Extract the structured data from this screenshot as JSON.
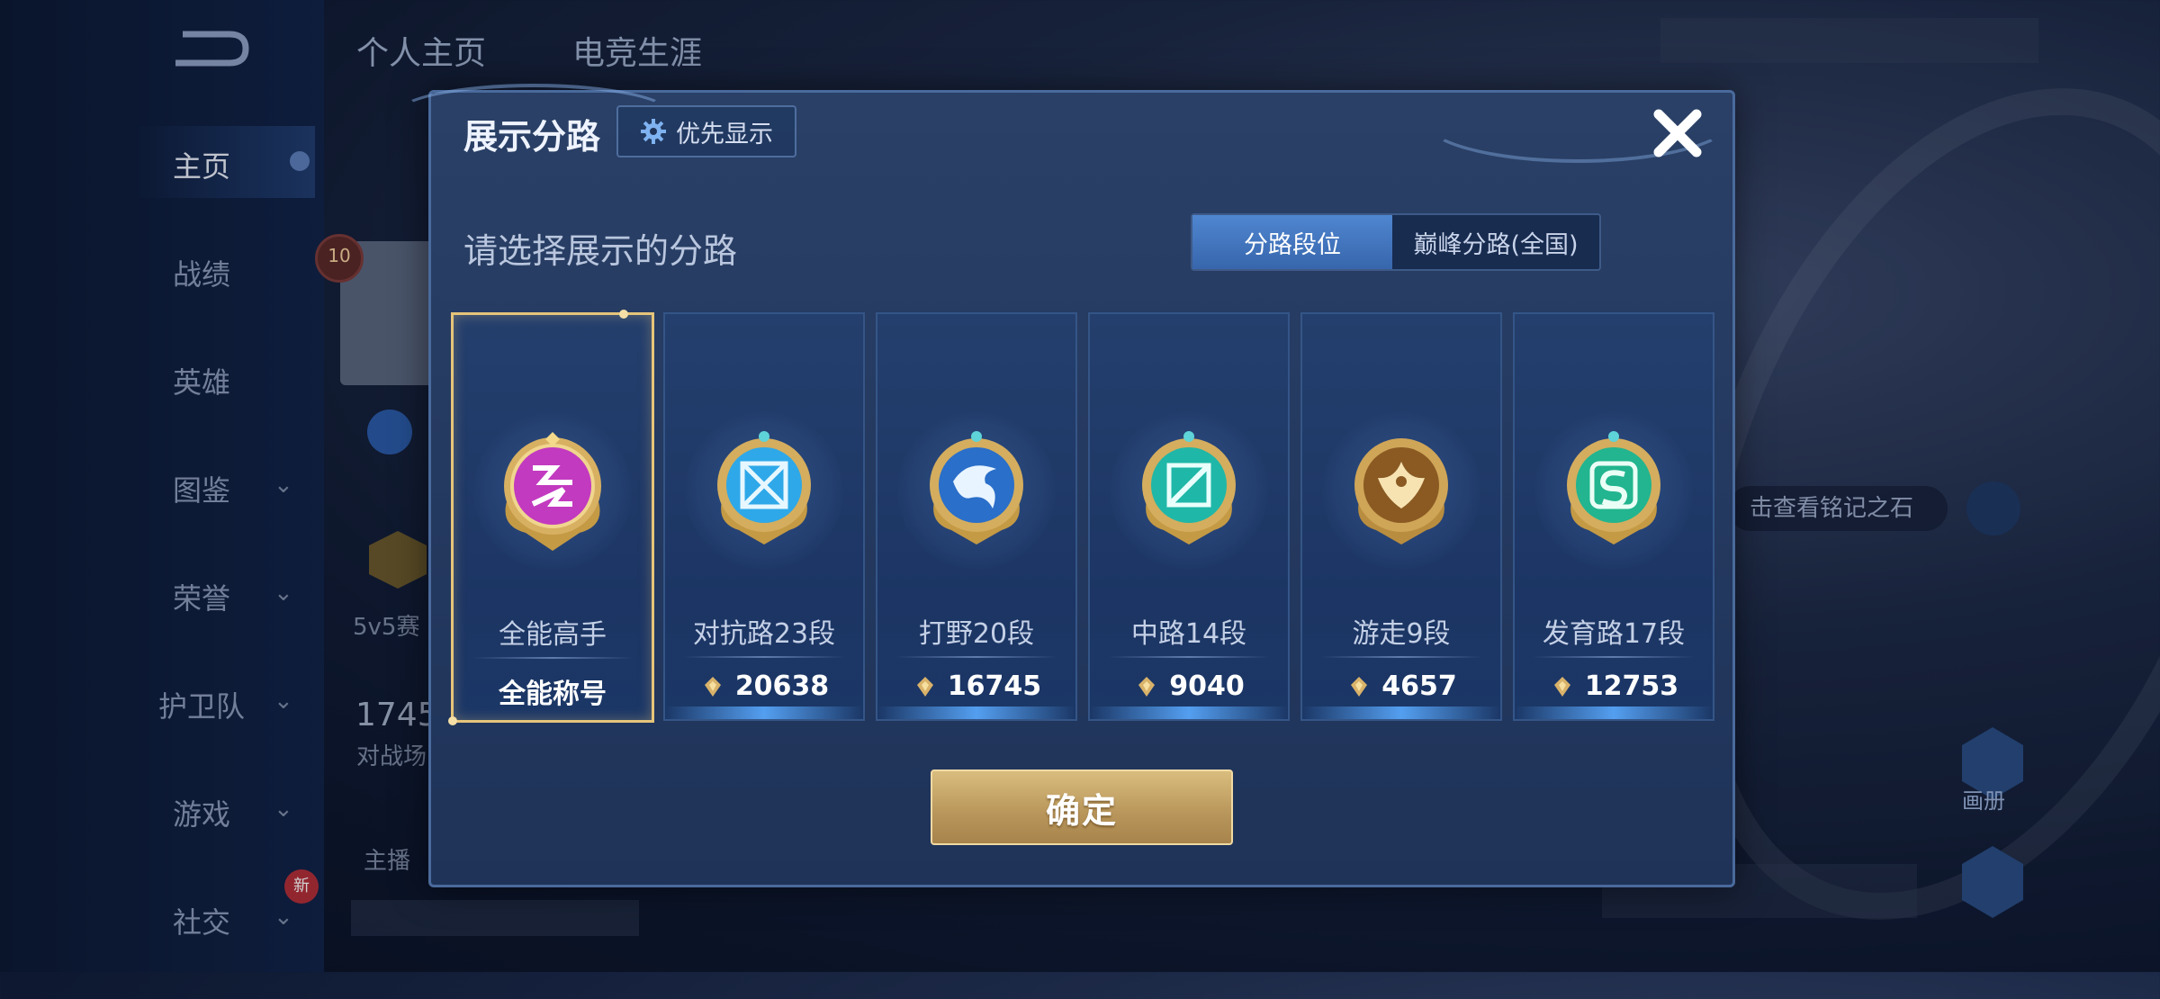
{
  "background": {
    "tabs": [
      "个人主页",
      "电竞生涯"
    ],
    "nav_items": [
      {
        "label": "主页",
        "chevron": false
      },
      {
        "label": "战绩",
        "chevron": false
      },
      {
        "label": "英雄",
        "chevron": false
      },
      {
        "label": "图鉴",
        "chevron": true
      },
      {
        "label": "荣誉",
        "chevron": true
      },
      {
        "label": "护卫队",
        "chevron": true
      },
      {
        "label": "游戏",
        "chevron": true
      },
      {
        "label": "社交",
        "chevron": true
      }
    ],
    "level": "10",
    "mode_text": "5v5赛",
    "count": "1745",
    "count_label": "对战场",
    "host_label": "主播",
    "hint_text": "击查看铭记之石",
    "right_label": "画册",
    "new_badge": "新"
  },
  "modal": {
    "title": "展示分路",
    "priority_label": "优先显示",
    "subtitle": "请选择展示的分路",
    "toggle": {
      "options": [
        "分路段位",
        "巅峰分路(全国)"
      ],
      "selected": "分路段位"
    },
    "cards": [
      {
        "name": "全能高手",
        "value": "全能称号",
        "icon": "all-round-emblem",
        "selected": true,
        "score_icon": false
      },
      {
        "name": "对抗路23段",
        "value": "20638",
        "icon": "clash-lane-emblem",
        "selected": false,
        "score_icon": true
      },
      {
        "name": "打野20段",
        "value": "16745",
        "icon": "jungle-emblem",
        "selected": false,
        "score_icon": true
      },
      {
        "name": "中路14段",
        "value": "9040",
        "icon": "mid-lane-emblem",
        "selected": false,
        "score_icon": true
      },
      {
        "name": "游走9段",
        "value": "4657",
        "icon": "roam-emblem",
        "selected": false,
        "score_icon": true
      },
      {
        "name": "发育路17段",
        "value": "12753",
        "icon": "farm-lane-emblem",
        "selected": false,
        "score_icon": true
      }
    ],
    "confirm_label": "确定"
  },
  "colors": {
    "accent_gold": "#e6c47a",
    "toggle_active": "#4f86d0",
    "panel": "#243f6d"
  }
}
